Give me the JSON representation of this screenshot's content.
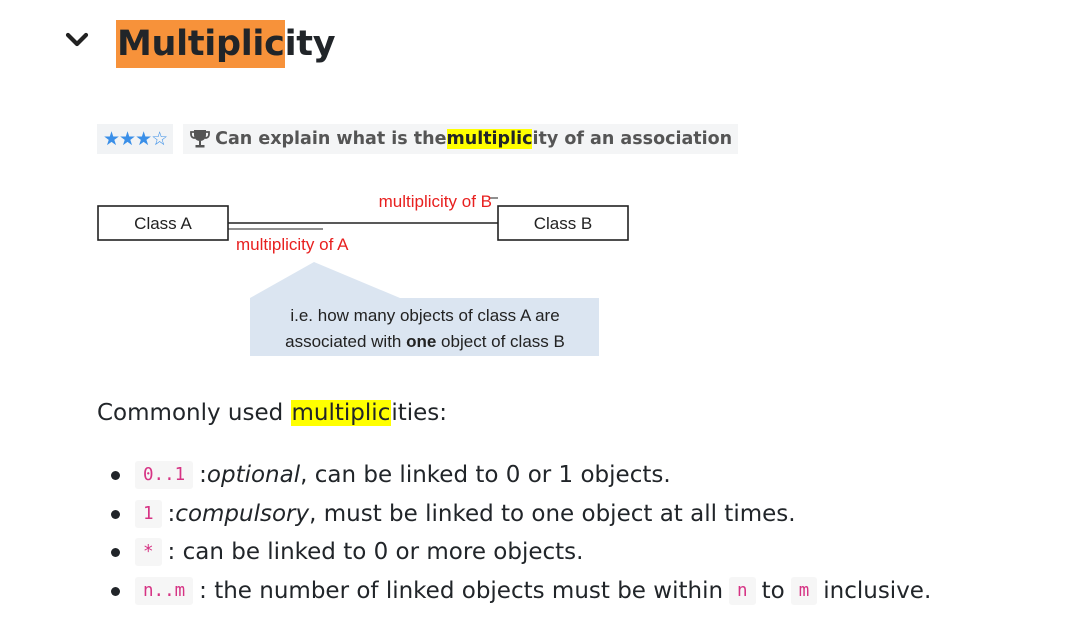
{
  "section": {
    "title_highlight": "Multiplic",
    "title_rest": "ity"
  },
  "outcome": {
    "stars_filled": "★★★",
    "stars_empty": "☆",
    "text_before": "Can explain what is the ",
    "text_highlight": "multiplic",
    "text_after": "ity of an association",
    "icon": "trophy-icon"
  },
  "diagram": {
    "class_a": "Class A",
    "class_b": "Class B",
    "label_mult_b": "multiplicity of B",
    "label_mult_a": "multiplicity of A",
    "callout_line1": "i.e. how many objects of class A are",
    "callout_line2_before": "associated with ",
    "callout_line2_bold": "one",
    "callout_line2_after": " object of class B"
  },
  "commonly": {
    "before": "Commonly used ",
    "highlight": "multiplic",
    "after": "ities:"
  },
  "items": [
    {
      "code": "0..1",
      "em": "optional",
      "text": ", can be linked to 0 or 1 objects."
    },
    {
      "code": "1",
      "em": "compulsory",
      "text": ", must be linked to one object at all times."
    },
    {
      "code": "*",
      "text": ": can be linked to 0 or more objects."
    },
    {
      "code": "n..m",
      "text_a": ": the number of linked objects must be within ",
      "code_n": "n",
      "text_b": " to ",
      "code_m": "m",
      "text_c": " inclusive."
    }
  ],
  "colors": {
    "title_highlight": "#f7923a",
    "text_highlight": "#ffff00",
    "diagram_red": "#e8201f",
    "callout_bg": "#dbe5f1",
    "code_color": "#d63384",
    "star_color": "#3a8fe8"
  }
}
